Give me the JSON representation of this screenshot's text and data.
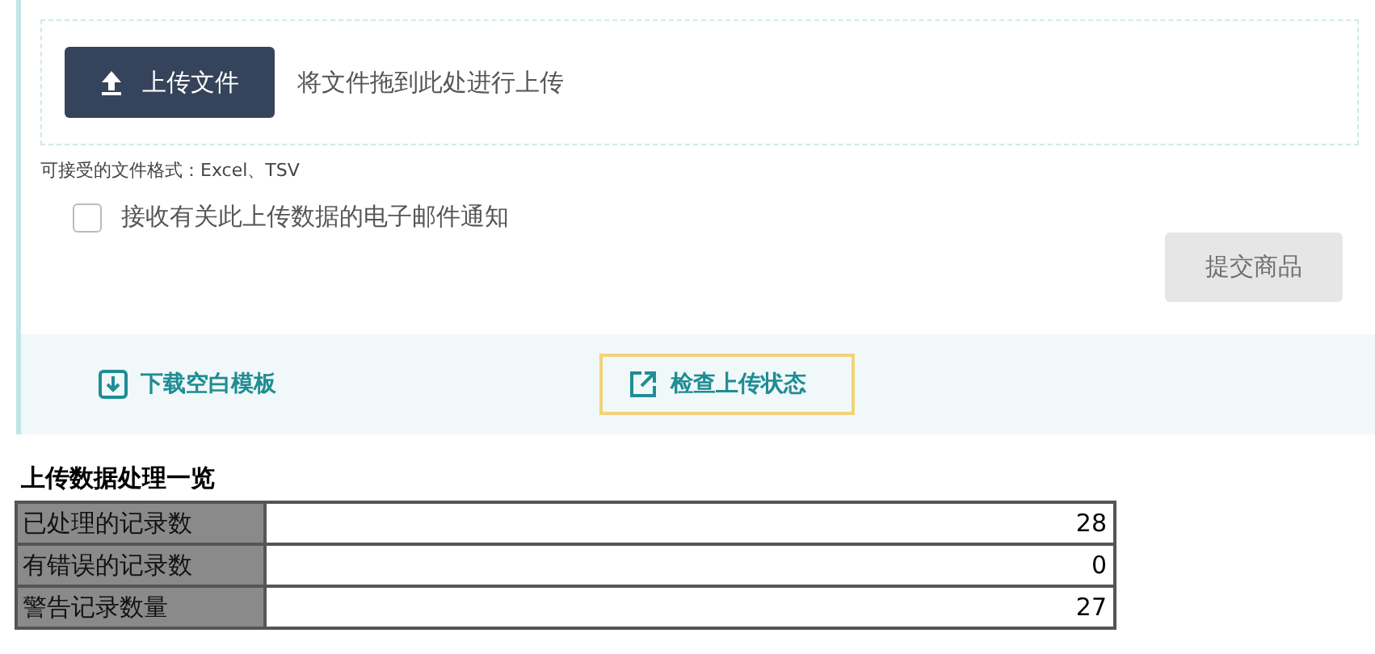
{
  "upload": {
    "button": "上传文件",
    "drop_hint": "将文件拖到此处进行上传",
    "formats": "可接受的文件格式：Excel、TSV",
    "email_option": {
      "label": "接收有关此上传数据的电子邮件通知",
      "checked": false
    },
    "submit": {
      "label": "提交商品",
      "disabled": true
    }
  },
  "footer_links": [
    {
      "label": "下载空白模板",
      "kind": "download",
      "focused": false
    },
    {
      "label": "检查上传状态",
      "kind": "external",
      "focused": true
    }
  ],
  "summary": {
    "title": "上传数据处理一览",
    "rows": [
      {
        "label": "已处理的记录数",
        "value": "28"
      },
      {
        "label": "有错误的记录数",
        "value": "0"
      },
      {
        "label": "警告记录数量",
        "value": "27"
      }
    ]
  }
}
